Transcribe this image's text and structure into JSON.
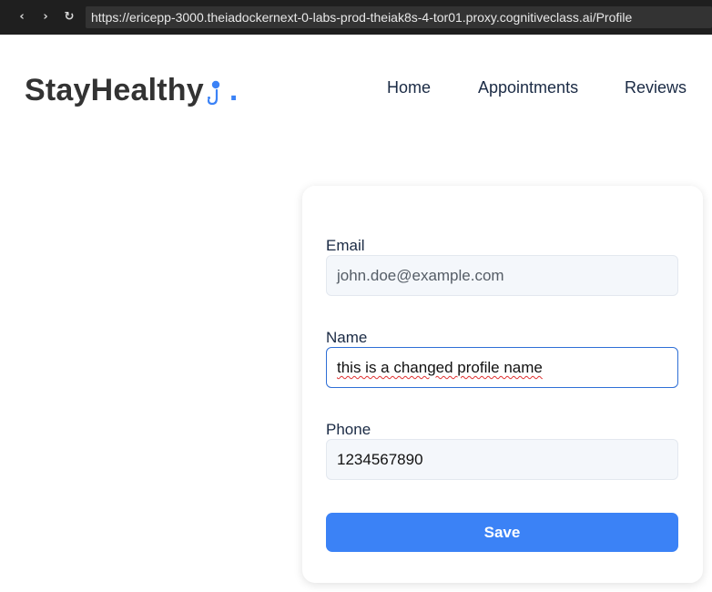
{
  "browser": {
    "url": "https://ericepp-3000.theiadockernext-0-labs-prod-theiak8s-4-tor01.proxy.cognitiveclass.ai/Profile",
    "back_icon": "chevron-left-icon",
    "forward_icon": "chevron-right-icon",
    "reload_icon": "reload-icon"
  },
  "header": {
    "logo_text": "StayHealthy",
    "logo_dot": ".",
    "logo_icon": "stethoscope-icon",
    "nav": [
      "Home",
      "Appointments",
      "Reviews"
    ]
  },
  "profile_form": {
    "email_label": "Email",
    "email_value": "john.doe@example.com",
    "name_label": "Name",
    "name_value": "this is a changed profile name",
    "phone_label": "Phone",
    "phone_value": "1234567890",
    "save_label": "Save"
  },
  "colors": {
    "accent": "#3b82f6",
    "browser_bar": "#1f1f1f",
    "text_dark": "#1a2a44"
  }
}
